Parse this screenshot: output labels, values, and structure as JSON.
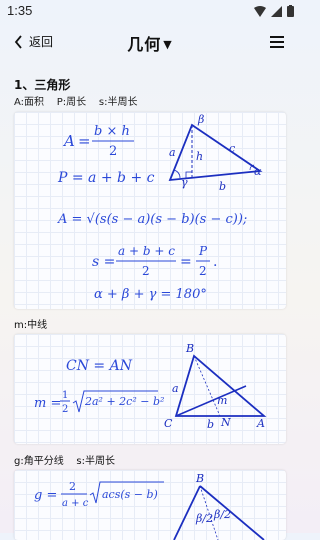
{
  "status": {
    "time": "1:35"
  },
  "nav": {
    "back_label": "返回",
    "title": "几何",
    "title_arrow": "▼"
  },
  "sections": [
    {
      "heading": "1、三角形",
      "legend": "A:面积    P:周长    s:半周长",
      "formulas": {
        "area": [
          "A",
          "=",
          "b × h",
          "2"
        ],
        "perimeter": "P = a + b + c",
        "heron": "A = √(s(s − a)(s − b)(s − c));",
        "semi": [
          "s =",
          "a + b + c",
          "2",
          "=",
          "P",
          "2",
          "."
        ],
        "angles": "α + β + γ = 180°"
      },
      "figure_labels": {
        "a": "a",
        "b": "b",
        "c": "c",
        "h": "h",
        "alpha": "α",
        "beta": "β",
        "gamma": "γ"
      }
    },
    {
      "heading": "m:中线",
      "formulas": {
        "cn": "CN = AN",
        "median_lhs": "m =",
        "median_frac_num": "1",
        "median_frac_den": "2",
        "median_root": "2a² + 2c² − b²"
      },
      "figure_labels": {
        "A": "A",
        "B": "B",
        "C": "C",
        "N": "N",
        "a": "a",
        "b": "b",
        "m": "m"
      }
    },
    {
      "heading": "g:角平分线    s:半周长",
      "formulas": {
        "bisector_lhs": "g =",
        "num": "2",
        "den": "a + c",
        "root": "acs(s − b)"
      },
      "figure_labels": {
        "B": "B",
        "half1": "β/2",
        "half2": "β/2"
      }
    }
  ],
  "colors": {
    "formula": "#2a48d8",
    "figure": "#1c2fc0"
  }
}
